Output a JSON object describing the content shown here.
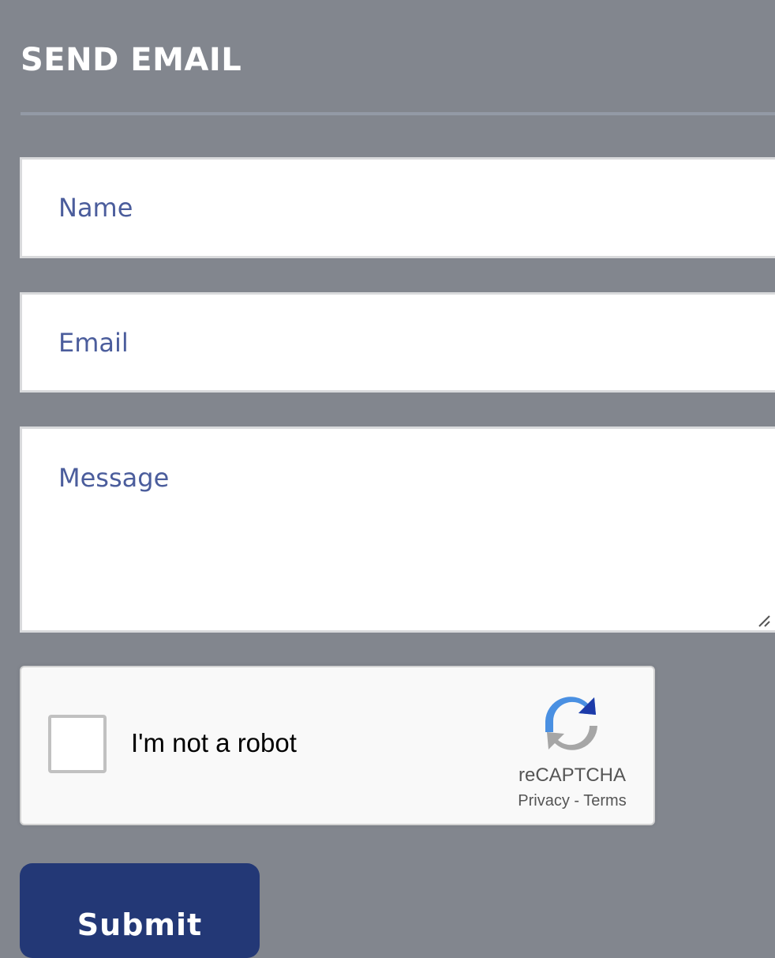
{
  "form": {
    "title": "SEND EMAIL",
    "name_placeholder": "Name",
    "email_placeholder": "Email",
    "message_placeholder": "Message",
    "submit_label": "Submit"
  },
  "recaptcha": {
    "label": "I'm not a robot",
    "brand": "reCAPTCHA",
    "privacy_label": "Privacy",
    "separator": " - ",
    "terms_label": "Terms",
    "icon": "recaptcha-logo-icon"
  },
  "colors": {
    "background": "#82868e",
    "input_text": "#4b5d9c",
    "submit_bg": "#233876",
    "title_text": "#ffffff"
  }
}
